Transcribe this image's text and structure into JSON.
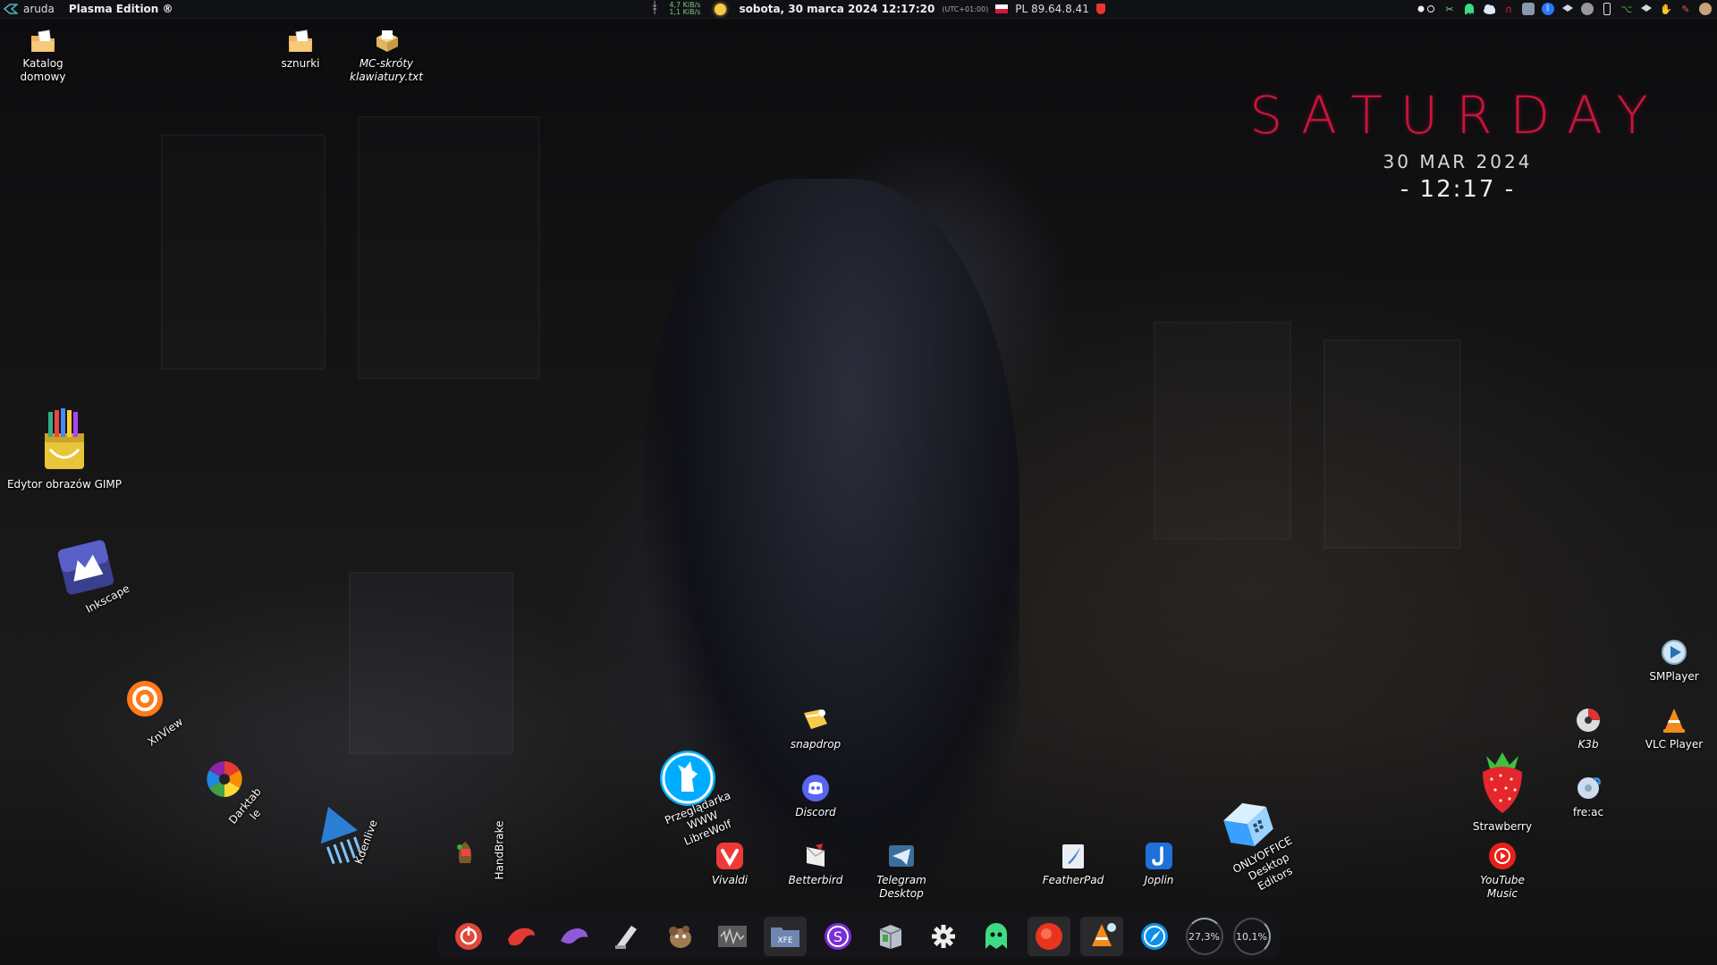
{
  "top_panel": {
    "user": "aruda",
    "edition": "Plasma Edition ®",
    "net_down": "4,7 KiB/s",
    "net_up": "1,1 KiB/s",
    "datetime": "sobota, 30 marca 2024 12:17:20",
    "timezone": "(UTC+01:00)",
    "ip": "PL 89.64.8.41",
    "tray": [
      "toggle-dots-icon",
      "scissors-icon",
      "ghost-icon",
      "cloud-icon",
      "magnet-icon",
      "vm-icon",
      "bluetooth-icon",
      "dropbox-icon",
      "camera-icon",
      "phone-icon",
      "network-icon",
      "dropbox-alt-icon",
      "hand-icon",
      "brush-icon",
      "avatar-icon"
    ]
  },
  "desktop_icons": [
    {
      "id": "katalog-domowy",
      "label": "Katalog\ndomowy",
      "icon": "home-folder-icon"
    },
    {
      "id": "sznurki",
      "label": "sznurki",
      "icon": "folder-icon"
    },
    {
      "id": "mc-skroty",
      "label": "MC-skróty\nklawiatury.txt",
      "icon": "text-file-icon"
    },
    {
      "id": "gimp",
      "label": "Edytor obrazów GIMP",
      "icon": "gimp-icon"
    },
    {
      "id": "inkscape",
      "label": "Inkscape",
      "icon": "inkscape-icon"
    },
    {
      "id": "xnview",
      "label": "XnView",
      "icon": "xnview-icon"
    },
    {
      "id": "darktable",
      "label": "Darktab\nle",
      "icon": "darktable-icon"
    },
    {
      "id": "kdenlive",
      "label": "Kdenlive",
      "icon": "kdenlive-icon"
    },
    {
      "id": "handbrake",
      "label": "HandBrake",
      "icon": "handbrake-icon"
    },
    {
      "id": "librewolf",
      "label": "Przeglądarka\nWWW LibreWolf",
      "icon": "librewolf-icon"
    },
    {
      "id": "snapdrop",
      "label": "snapdrop",
      "icon": "snapdrop-icon"
    },
    {
      "id": "discord",
      "label": "Discord",
      "icon": "discord-icon"
    },
    {
      "id": "vivaldi",
      "label": "Vivaldi",
      "icon": "vivaldi-icon"
    },
    {
      "id": "betterbird",
      "label": "Betterbird",
      "icon": "betterbird-icon"
    },
    {
      "id": "telegram",
      "label": "Telegram\nDesktop",
      "icon": "telegram-icon"
    },
    {
      "id": "featherpad",
      "label": "FeatherPad",
      "icon": "featherpad-icon"
    },
    {
      "id": "joplin",
      "label": "Joplin",
      "icon": "joplin-icon"
    },
    {
      "id": "onlyoffice",
      "label": "ONLYOFFICE\nDesktop Editors",
      "icon": "onlyoffice-icon"
    },
    {
      "id": "smplayer",
      "label": "SMPlayer",
      "icon": "smplayer-icon"
    },
    {
      "id": "k3b",
      "label": "K3b",
      "icon": "k3b-icon"
    },
    {
      "id": "vlc",
      "label": "VLC Player",
      "icon": "vlc-icon"
    },
    {
      "id": "strawberry",
      "label": "Strawberry",
      "icon": "strawberry-icon"
    },
    {
      "id": "freac",
      "label": "fre:ac",
      "icon": "freac-icon"
    },
    {
      "id": "youtube-music",
      "label": "YouTube\nMusic",
      "icon": "youtube-music-icon"
    }
  ],
  "clock": {
    "day": "SATURDAY",
    "date": "30 MAR 2024",
    "time": "- 12:17 -"
  },
  "dock": {
    "items": [
      "power-icon",
      "bird-red-icon",
      "bird-purple-icon",
      "notes-icon",
      "gimp-mascot-icon",
      "audio-editor-icon",
      "xfe-file-manager-icon",
      "s-app-icon",
      "package-icon",
      "settings-gear-icon",
      "ghost-icon",
      "record-icon",
      "vlc-icon",
      "browser-icon"
    ],
    "cpu": "27,3%",
    "ram": "10,1%"
  },
  "colors": {
    "accent": "#c8153c",
    "panel": "#101114"
  }
}
